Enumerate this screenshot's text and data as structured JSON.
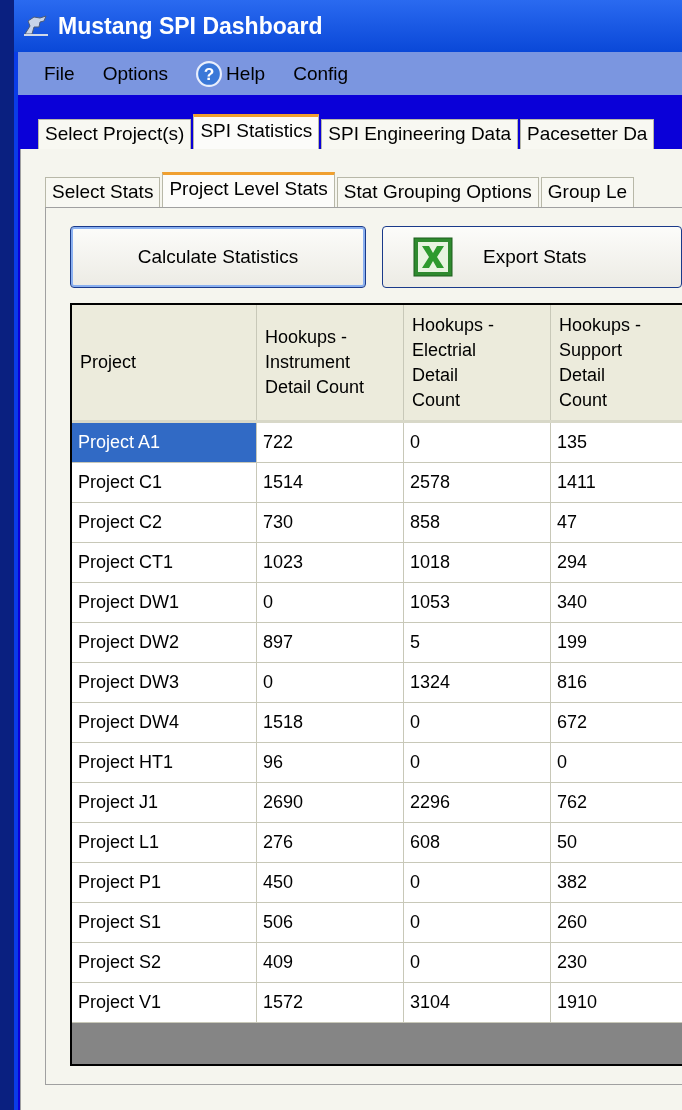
{
  "window": {
    "title": "Mustang SPI Dashboard"
  },
  "menu": [
    {
      "label": "File",
      "kind": "text"
    },
    {
      "label": "Options",
      "kind": "text"
    },
    {
      "label": "Help",
      "kind": "help",
      "icon": "?"
    },
    {
      "label": "Config",
      "kind": "text"
    }
  ],
  "tabs": [
    {
      "label": "Select Project(s)",
      "selected": false
    },
    {
      "label": "SPI Statistics",
      "selected": true
    },
    {
      "label": "SPI Engineering Data",
      "selected": false
    },
    {
      "label": "Pacesetter Da",
      "selected": false
    }
  ],
  "subtabs": [
    {
      "label": "Select Stats",
      "selected": false
    },
    {
      "label": "Project Level Stats",
      "selected": true
    },
    {
      "label": "Stat Grouping Options",
      "selected": false
    },
    {
      "label": "Group Le",
      "selected": false
    }
  ],
  "buttons": [
    {
      "label": "Calculate Statistics",
      "kind": "plain"
    },
    {
      "label": "Export Stats",
      "kind": "spreadsheet"
    }
  ],
  "table": {
    "columns": [
      "Project",
      "Hookups - Instrument Detail Count",
      "Hookups - Electrial Detail Count",
      "Hookups - Support Detail Count"
    ],
    "rows": [
      {
        "cells": [
          "Project A1",
          "722",
          "0",
          "135"
        ],
        "selected": true
      },
      {
        "cells": [
          "Project C1",
          "1514",
          "2578",
          "1411"
        ],
        "selected": false
      },
      {
        "cells": [
          "Project C2",
          "730",
          "858",
          "47"
        ],
        "selected": false
      },
      {
        "cells": [
          "Project CT1",
          "1023",
          "1018",
          "294"
        ],
        "selected": false
      },
      {
        "cells": [
          "Project DW1",
          "0",
          "1053",
          "340"
        ],
        "selected": false
      },
      {
        "cells": [
          "Project DW2",
          "897",
          "5",
          "199"
        ],
        "selected": false
      },
      {
        "cells": [
          "Project DW3",
          "0",
          "1324",
          "816"
        ],
        "selected": false
      },
      {
        "cells": [
          "Project DW4",
          "1518",
          "0",
          "672"
        ],
        "selected": false
      },
      {
        "cells": [
          "Project HT1",
          "96",
          "0",
          "0"
        ],
        "selected": false
      },
      {
        "cells": [
          "Project J1",
          "2690",
          "2296",
          "762"
        ],
        "selected": false
      },
      {
        "cells": [
          "Project L1",
          "276",
          "608",
          "50"
        ],
        "selected": false
      },
      {
        "cells": [
          "Project P1",
          "450",
          "0",
          "382"
        ],
        "selected": false
      },
      {
        "cells": [
          "Project S1",
          "506",
          "0",
          "260"
        ],
        "selected": false
      },
      {
        "cells": [
          "Project S2",
          "409",
          "0",
          "230"
        ],
        "selected": false
      },
      {
        "cells": [
          "Project V1",
          "1572",
          "3104",
          "1910"
        ],
        "selected": false
      }
    ]
  }
}
